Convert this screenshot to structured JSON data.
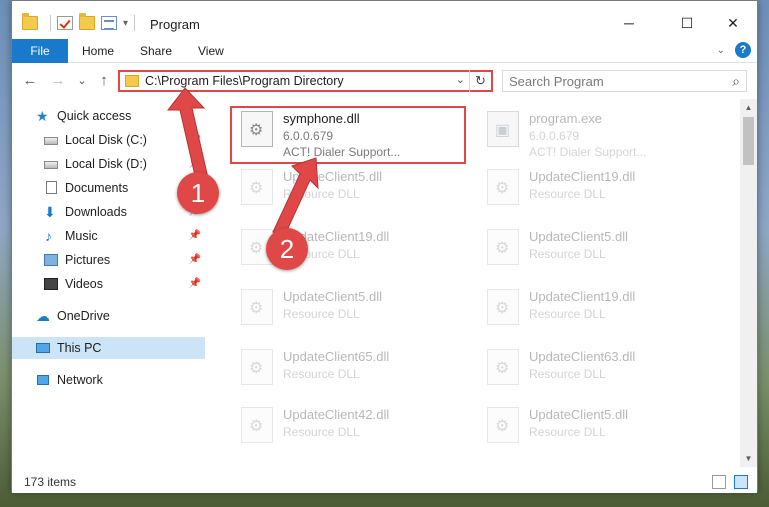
{
  "window": {
    "title": "Program",
    "minimize": "─",
    "maximize": "☐",
    "close": "✕"
  },
  "ribbon": {
    "tabs": [
      "File",
      "Home",
      "Share",
      "View"
    ],
    "collapse": "⌄",
    "help": "?"
  },
  "navigation": {
    "back": "←",
    "forward": "→",
    "recent": "⌄",
    "up": "↑"
  },
  "address": {
    "path": "C:\\Program Files\\Program Directory",
    "dropdown": "⌄",
    "refresh": "↻"
  },
  "search": {
    "placeholder": "Search Program",
    "icon": "search-icon"
  },
  "nav_pane": {
    "items": [
      {
        "label": "Quick access",
        "icon": "star-icon",
        "pinned": false
      },
      {
        "label": "Local Disk (C:)",
        "icon": "disk-icon",
        "pinned": true
      },
      {
        "label": "Local Disk (D:)",
        "icon": "disk-icon",
        "pinned": true
      },
      {
        "label": "Documents",
        "icon": "document-icon",
        "pinned": true
      },
      {
        "label": "Downloads",
        "icon": "download-icon",
        "pinned": true
      },
      {
        "label": "Music",
        "icon": "music-icon",
        "pinned": true
      },
      {
        "label": "Pictures",
        "icon": "pictures-icon",
        "pinned": true
      },
      {
        "label": "Videos",
        "icon": "video-icon",
        "pinned": true
      },
      {
        "label": "OneDrive",
        "icon": "cloud-icon",
        "pinned": false
      },
      {
        "label": "This PC",
        "icon": "computer-icon",
        "pinned": false,
        "selected": true
      },
      {
        "label": "Network",
        "icon": "network-icon",
        "pinned": false
      }
    ]
  },
  "files": [
    {
      "name": "symphone.dll",
      "line2": "6.0.0.679",
      "line3": "ACT! Dialer Support...",
      "icon": "dll-icon",
      "highlighted": true
    },
    {
      "name": "program.exe",
      "line2": "6.0.0.679",
      "line3": "ACT! Dialer Support...",
      "icon": "exe-icon"
    },
    {
      "name": "UpdateClient5.dll",
      "line2": "Resource DLL",
      "icon": "dll-icon"
    },
    {
      "name": "UpdateClient19.dll",
      "line2": "Resource DLL",
      "icon": "dll-icon"
    },
    {
      "name": "UpdateClient19.dll",
      "line2": "Resource DLL",
      "icon": "dll-icon"
    },
    {
      "name": "UpdateClient5.dll",
      "line2": "Resource DLL",
      "icon": "dll-icon"
    },
    {
      "name": "UpdateClient5.dll",
      "line2": "Resource DLL",
      "icon": "dll-icon"
    },
    {
      "name": "UpdateClient19.dll",
      "line2": "Resource DLL",
      "icon": "dll-icon"
    },
    {
      "name": "UpdateClient65.dll",
      "line2": "Resource DLL",
      "icon": "dll-icon"
    },
    {
      "name": "UpdateClient63.dll",
      "line2": "Resource DLL",
      "icon": "dll-icon"
    },
    {
      "name": "UpdateClient42.dll",
      "line2": "Resource DLL",
      "icon": "dll-icon"
    },
    {
      "name": "UpdateClient5.dll",
      "line2": "Resource DLL",
      "icon": "dll-icon"
    }
  ],
  "status": {
    "item_count": "173 items"
  },
  "markers": [
    "1",
    "2"
  ],
  "colors": {
    "accent": "#1979ca",
    "annotation": "#e04848",
    "selection": "#cce4f7"
  }
}
